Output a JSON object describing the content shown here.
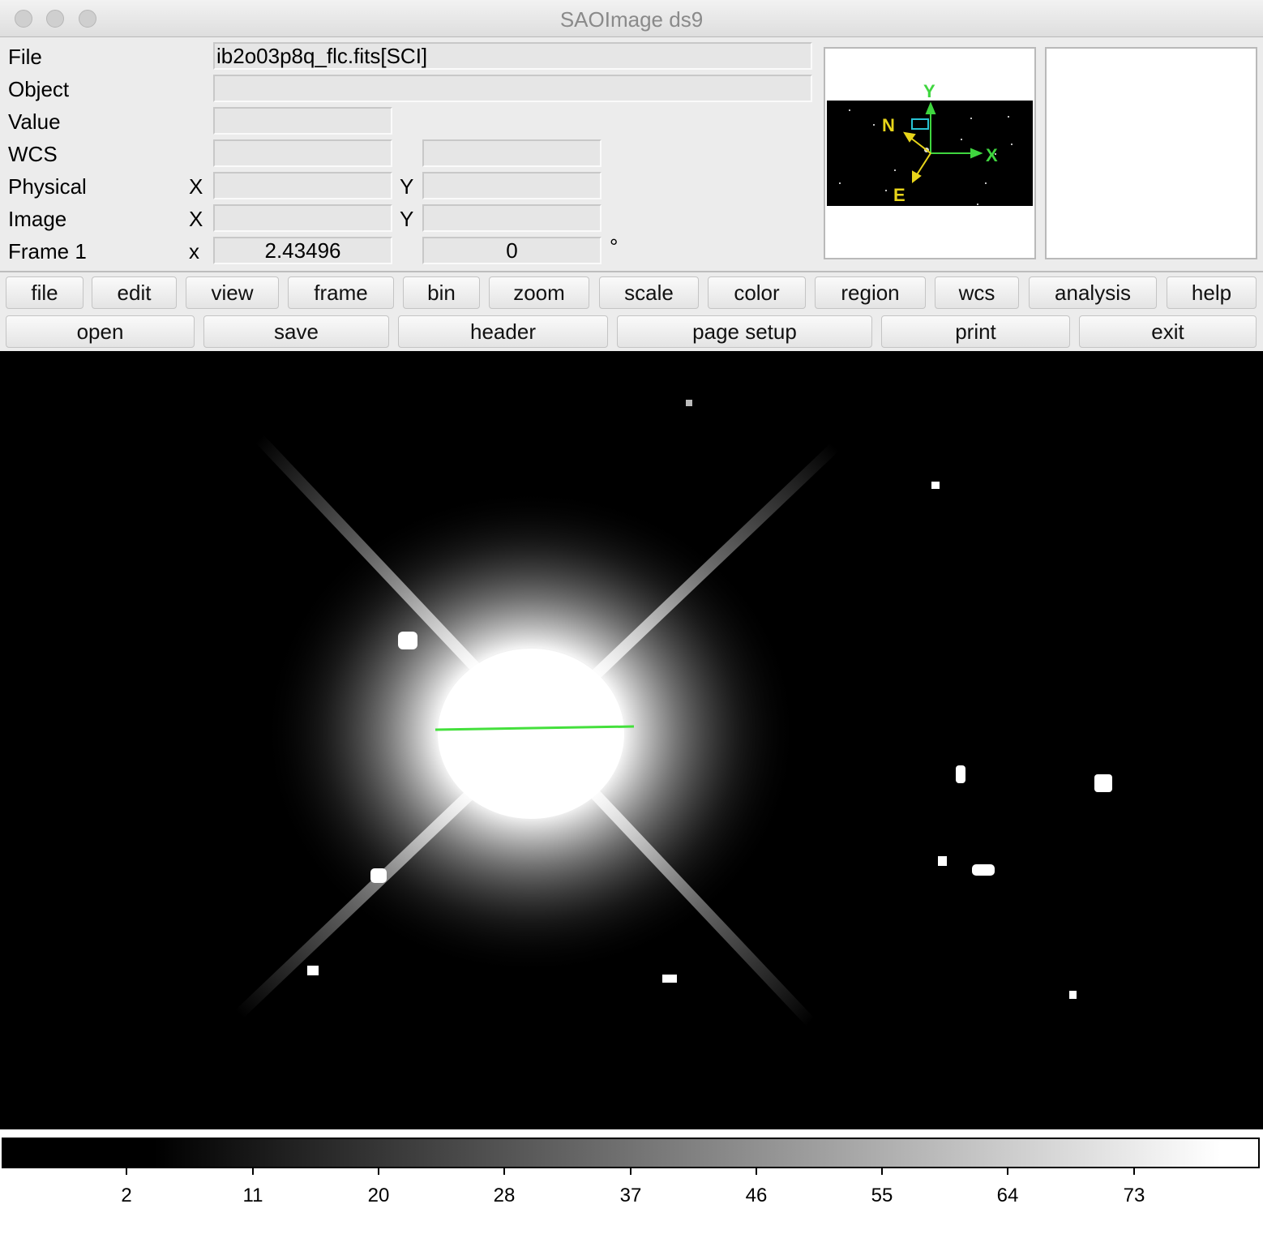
{
  "window": {
    "title": "SAOImage ds9"
  },
  "info": {
    "file_label": "File",
    "file_value": "ib2o03p8q_flc.fits[SCI]",
    "object_label": "Object",
    "object_value": "",
    "value_label": "Value",
    "value_value": "",
    "wcs_label": "WCS",
    "wcs_value1": "",
    "wcs_value2": "",
    "physical_label": "Physical",
    "physical_x_label": "X",
    "physical_x": "",
    "physical_y_label": "Y",
    "physical_y": "",
    "image_label": "Image",
    "image_x_label": "X",
    "image_x": "",
    "image_y_label": "Y",
    "image_y": "",
    "frame_label": "Frame 1",
    "frame_x_label": "x",
    "frame_zoom": "2.43496",
    "frame_angle": "0",
    "degree_symbol": "°"
  },
  "panner": {
    "compass_n": "N",
    "compass_e": "E",
    "axis_x": "X",
    "axis_y": "Y",
    "colors": {
      "compass": "#e8d51a",
      "axes": "#3fd63f",
      "bbox": "#29c3d4"
    }
  },
  "menu": [
    "file",
    "edit",
    "view",
    "frame",
    "bin",
    "zoom",
    "scale",
    "color",
    "region",
    "wcs",
    "analysis",
    "help"
  ],
  "buttons": [
    "open",
    "save",
    "header",
    "page setup",
    "print",
    "exit"
  ],
  "colorbar": {
    "ticks": [
      "2",
      "11",
      "20",
      "28",
      "37",
      "46",
      "55",
      "64",
      "73"
    ]
  },
  "region": {
    "type": "line",
    "color": "#44e03c"
  }
}
